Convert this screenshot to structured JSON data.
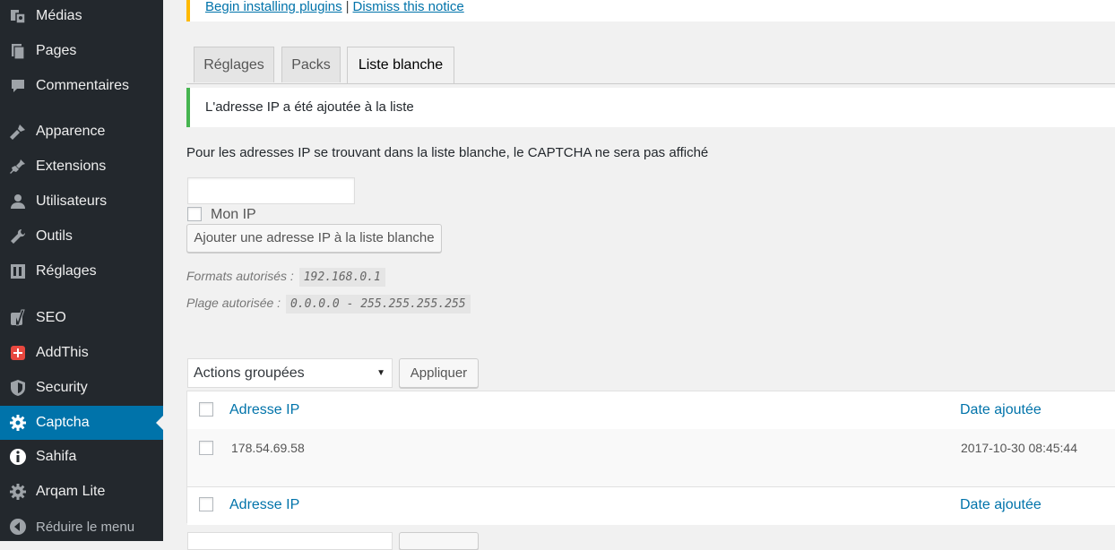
{
  "sidebar": {
    "items": [
      {
        "label": "Médias",
        "icon": "media-icon"
      },
      {
        "label": "Pages",
        "icon": "pages-icon"
      },
      {
        "label": "Commentaires",
        "icon": "comments-icon"
      },
      {
        "label": "Apparence",
        "icon": "appearance-icon"
      },
      {
        "label": "Extensions",
        "icon": "plugins-icon"
      },
      {
        "label": "Utilisateurs",
        "icon": "users-icon"
      },
      {
        "label": "Outils",
        "icon": "tools-icon"
      },
      {
        "label": "Réglages",
        "icon": "settings-icon"
      },
      {
        "label": "SEO",
        "icon": "yoast-icon"
      },
      {
        "label": "AddThis",
        "icon": "addthis-icon"
      },
      {
        "label": "Security",
        "icon": "shield-icon"
      },
      {
        "label": "Captcha",
        "icon": "gear-icon"
      },
      {
        "label": "Sahifa",
        "icon": "info-icon"
      },
      {
        "label": "Arqam Lite",
        "icon": "gear-icon"
      },
      {
        "label": "Réduire le menu",
        "icon": "collapse-icon"
      }
    ],
    "active_color": "#0073aa"
  },
  "notice_top": {
    "link1": "Begin installing plugins",
    "separator": "|",
    "link2": "Dismiss this notice"
  },
  "tabs": [
    {
      "label": "Réglages"
    },
    {
      "label": "Packs"
    },
    {
      "label": "Liste blanche"
    }
  ],
  "success_notice": "L'adresse IP a été ajoutée à la liste",
  "description": "Pour les adresses IP se trouvant dans la liste blanche, le CAPTCHA ne sera pas affiché",
  "ip_input": {
    "value": "",
    "placeholder": ""
  },
  "my_ip_label": "Mon IP",
  "add_button": "Ajouter une adresse IP à la liste blanche",
  "formats": {
    "allowed_label": "Formats autorisés :",
    "allowed_value": "192.168.0.1",
    "range_label": "Plage autorisée :",
    "range_value": "0.0.0.0 - 255.255.255.255"
  },
  "bulk": {
    "select": "Actions groupées",
    "apply": "Appliquer"
  },
  "table": {
    "col_ip": "Adresse IP",
    "col_date": "Date ajoutée",
    "rows": [
      {
        "ip": "178.54.69.58",
        "date": "2017-10-30 08:45:44"
      }
    ]
  }
}
